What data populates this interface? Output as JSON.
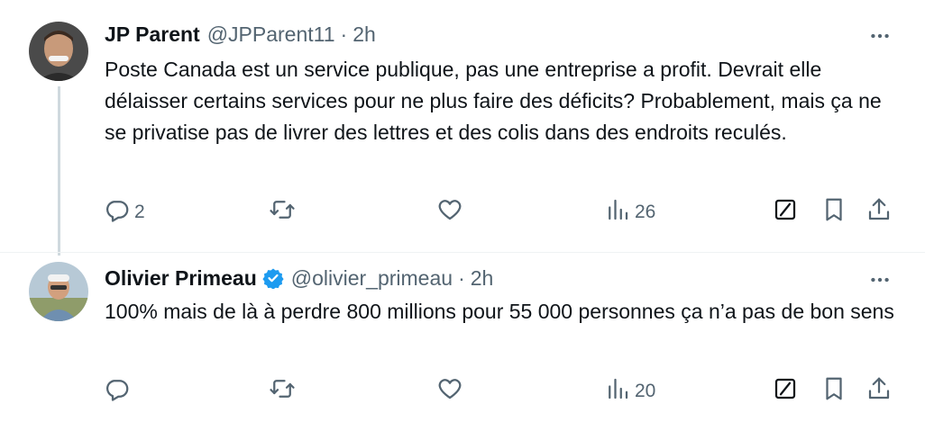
{
  "tweets": [
    {
      "author_name": "JP Parent",
      "handle": "@JPParent11",
      "separator": "·",
      "time": "2h",
      "text": "Poste Canada est un service publique, pas une entreprise a profit. Devrait elle délaisser certains services pour ne plus faire des déficits? Probablement, mais ça ne se privatise pas de livrer des lettres et des colis dans des endroits reculés.",
      "reply_count": "2",
      "retweet_count": "",
      "like_count": "",
      "view_count": "26",
      "verified": false,
      "avatar_icon": "avatar-photo"
    },
    {
      "author_name": "Olivier Primeau",
      "handle": "@olivier_primeau",
      "separator": "·",
      "time": "2h",
      "text": "100% mais de là à perdre 800 millions pour 55 000 personnes ça n’a pas de bon sens",
      "reply_count": "",
      "retweet_count": "",
      "like_count": "",
      "view_count": "20",
      "verified": true,
      "avatar_icon": "avatar-photo"
    }
  ],
  "icons": {
    "more": "more-horizontal-icon",
    "reply": "reply-icon",
    "retweet": "retweet-icon",
    "like": "heart-icon",
    "views": "views-bar-chart-icon",
    "grok": "grok-icon",
    "bookmark": "bookmark-icon",
    "share": "share-icon",
    "verified": "verified-badge-icon"
  },
  "colors": {
    "text": "#0f1419",
    "secondary": "#536471",
    "verified": "#1d9bf0",
    "divider": "#eff3f4",
    "thread_line": "#cfd9de"
  }
}
